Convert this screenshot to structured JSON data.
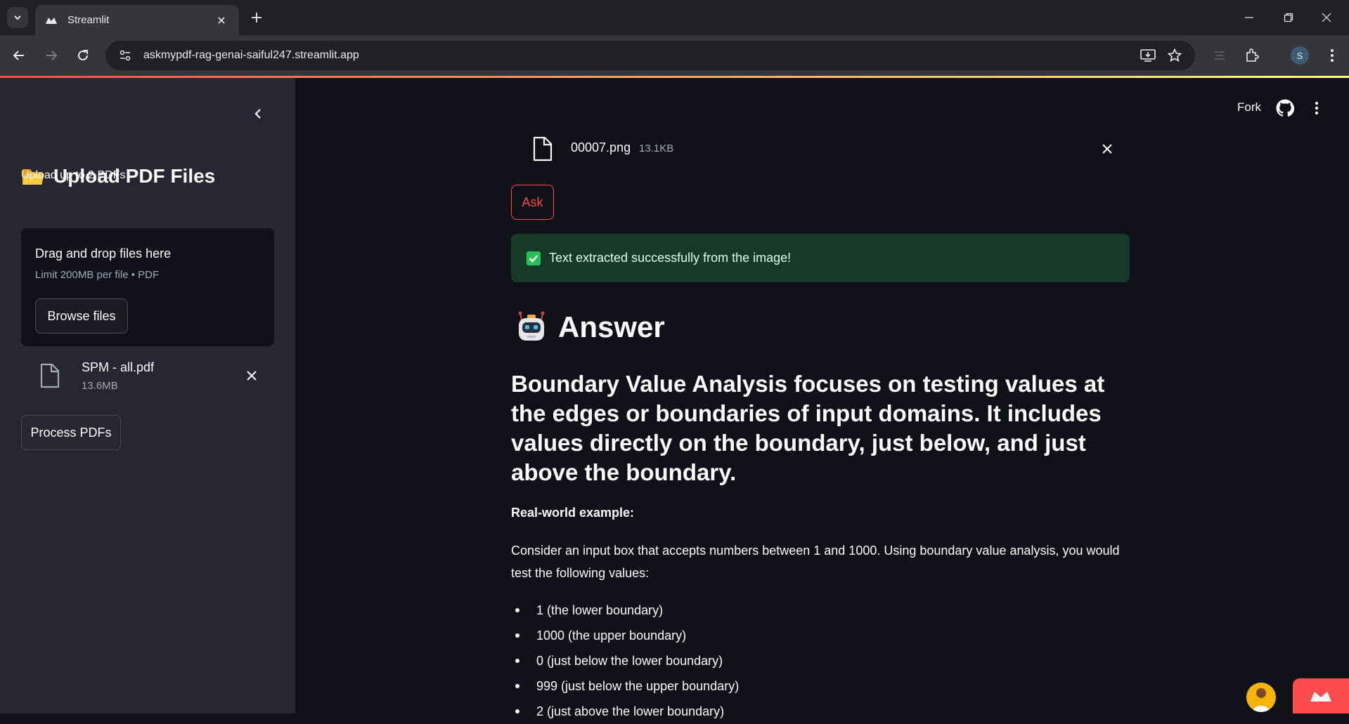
{
  "browser": {
    "tab_title": "Streamlit",
    "url": "askmypdf-rag-genai-saiful247.streamlit.app",
    "profile_initial": "S"
  },
  "sidebar": {
    "title": "Upload PDF Files",
    "uploader_label": "Upload up to 2 PDFs",
    "dropzone_title": "Drag and drop files here",
    "dropzone_limit": "Limit 200MB per file • PDF",
    "browse_label": "Browse files",
    "uploaded_file": {
      "name": "SPM - all.pdf",
      "size": "13.6MB"
    },
    "process_label": "Process PDFs"
  },
  "header": {
    "fork_label": "Fork"
  },
  "main": {
    "image_file": {
      "name": "00007.png",
      "size": "13.1KB"
    },
    "ask_label": "Ask",
    "success_text": "Text extracted successfully from the image!",
    "answer_heading": "Answer",
    "lead": "Boundary Value Analysis focuses on testing values at the edges or boundaries of input domains. It includes values directly on the boundary, just below, and just above the boundary.",
    "example_label": "Real-world example:",
    "example_text": "Consider an input box that accepts numbers between 1 and 1000. Using boundary value analysis, you would test the following values:",
    "bullets": [
      "1 (the lower boundary)",
      "1000 (the upper boundary)",
      "0 (just below the lower boundary)",
      "999 (just below the upper boundary)",
      "2 (just above the lower boundary)"
    ]
  },
  "colors": {
    "accent": "#ff4b4b",
    "success_bg": "#173928",
    "sidebar_bg": "#262730",
    "main_bg": "#0e1117"
  },
  "icons": [
    "tab-search-icon",
    "streamlit-logo-icon",
    "close-icon",
    "plus-icon",
    "minimize-icon",
    "restore-icon",
    "back-icon",
    "forward-icon",
    "reload-icon",
    "site-info-icon",
    "install-icon",
    "star-icon",
    "extensions-icon",
    "menu-icon",
    "chevron-left-icon",
    "folder-icon",
    "file-icon",
    "github-icon",
    "robot-icon",
    "check-icon"
  ]
}
